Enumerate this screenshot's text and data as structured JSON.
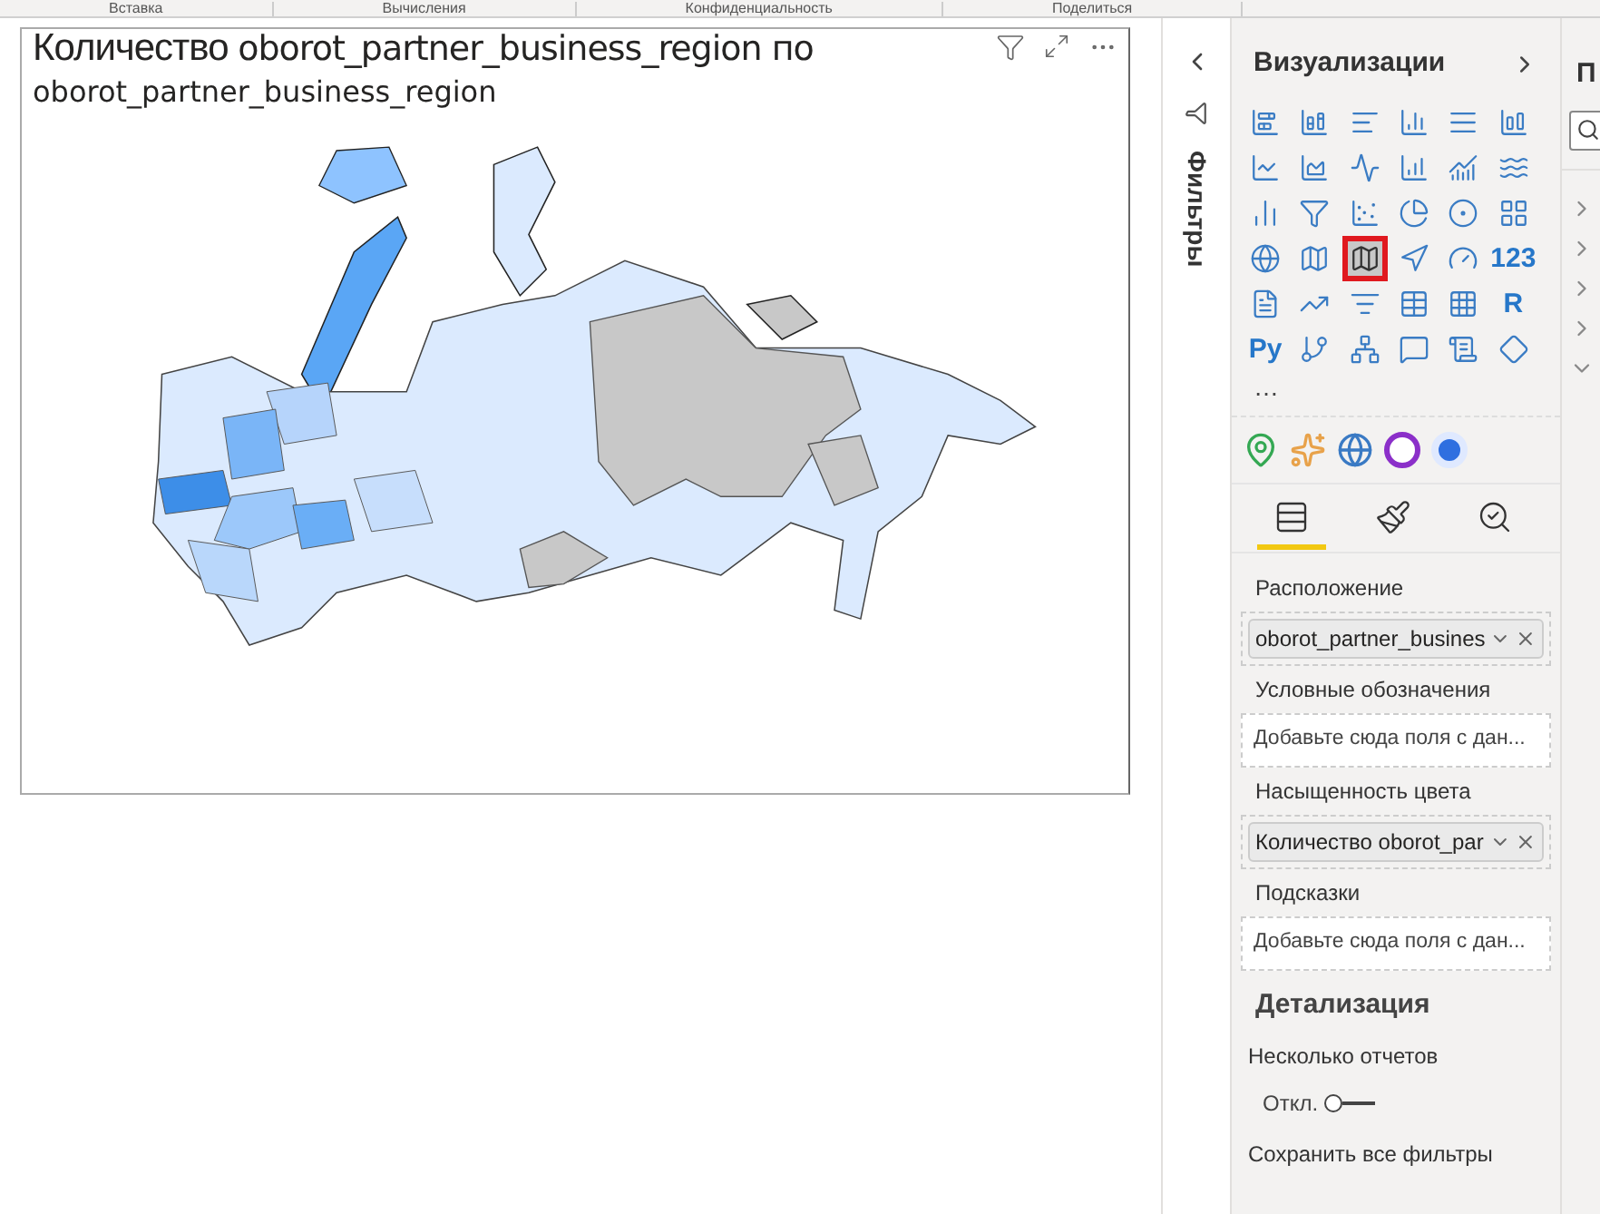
{
  "ribbon": {
    "labels": [
      "Вставка",
      "Вычисления",
      "Конфиденциальность",
      "Поделиться"
    ]
  },
  "visual": {
    "title_parts": [
      "Количество ",
      "oborot_partner_business_region по"
    ],
    "title_line2": "oborot_partner_business_region"
  },
  "filters_pane": {
    "title": "Фильтры"
  },
  "visualizations_pane": {
    "title": "Визуализации",
    "visual_types": [
      {
        "kind": "stacked-bar",
        "selected": false
      },
      {
        "kind": "stacked-column",
        "selected": false
      },
      {
        "kind": "clustered-bar",
        "selected": false
      },
      {
        "kind": "clustered-column",
        "selected": false
      },
      {
        "kind": "bar-100",
        "selected": false
      },
      {
        "kind": "column-100",
        "selected": false
      },
      {
        "kind": "line",
        "selected": false
      },
      {
        "kind": "area",
        "selected": false
      },
      {
        "kind": "stacked-area",
        "selected": false
      },
      {
        "kind": "line-column",
        "selected": false
      },
      {
        "kind": "line-stacked-column",
        "selected": false
      },
      {
        "kind": "ribbon",
        "selected": false
      },
      {
        "kind": "waterfall",
        "selected": false
      },
      {
        "kind": "funnel",
        "selected": false
      },
      {
        "kind": "scatter",
        "selected": false
      },
      {
        "kind": "pie",
        "selected": false
      },
      {
        "kind": "donut",
        "selected": false
      },
      {
        "kind": "treemap",
        "selected": false
      },
      {
        "kind": "globe",
        "selected": false
      },
      {
        "kind": "filled-map",
        "selected": false
      },
      {
        "kind": "shape-map",
        "selected": true
      },
      {
        "kind": "arrow",
        "selected": false
      },
      {
        "kind": "gauge",
        "selected": false
      },
      {
        "kind": "text",
        "label": "123",
        "selected": false
      },
      {
        "kind": "multi-card",
        "selected": false
      },
      {
        "kind": "kpi",
        "selected": false
      },
      {
        "kind": "slicer",
        "selected": false
      },
      {
        "kind": "table",
        "selected": false
      },
      {
        "kind": "matrix",
        "selected": false
      },
      {
        "kind": "text",
        "label": "R",
        "selected": false
      },
      {
        "kind": "text",
        "label": "Py",
        "selected": false
      },
      {
        "kind": "influencers",
        "selected": false
      },
      {
        "kind": "decomposition",
        "selected": false
      },
      {
        "kind": "qa",
        "selected": false
      },
      {
        "kind": "narrative",
        "selected": false
      },
      {
        "kind": "diamond",
        "selected": false
      }
    ],
    "more": "…",
    "pane_tabs": [
      {
        "kind": "fields",
        "selected": true
      },
      {
        "kind": "format",
        "selected": false
      },
      {
        "kind": "analytics",
        "selected": false
      }
    ],
    "wells": [
      {
        "label": "Расположение",
        "kind": "filled",
        "value": "oborot_partner_busines"
      },
      {
        "label": "Условные обозначения",
        "kind": "empty",
        "placeholder": "Добавьте сюда поля с дан..."
      },
      {
        "label": "Насыщенность цвета",
        "kind": "filled",
        "value": "Количество oborot_par"
      },
      {
        "label": "Подсказки",
        "kind": "empty",
        "placeholder": "Добавьте сюда поля с дан..."
      }
    ],
    "drillthrough": {
      "heading": "Детализация",
      "cross_report": {
        "label": "Несколько отчетов",
        "state_text": "Откл.",
        "on": false
      },
      "keep_filters": "Сохранить все фильтры"
    }
  },
  "fields_pane": {
    "title": "П",
    "items": [
      {
        "expanded": false
      },
      {
        "expanded": false
      },
      {
        "expanded": false
      },
      {
        "expanded": false
      },
      {
        "expanded": true
      }
    ]
  }
}
